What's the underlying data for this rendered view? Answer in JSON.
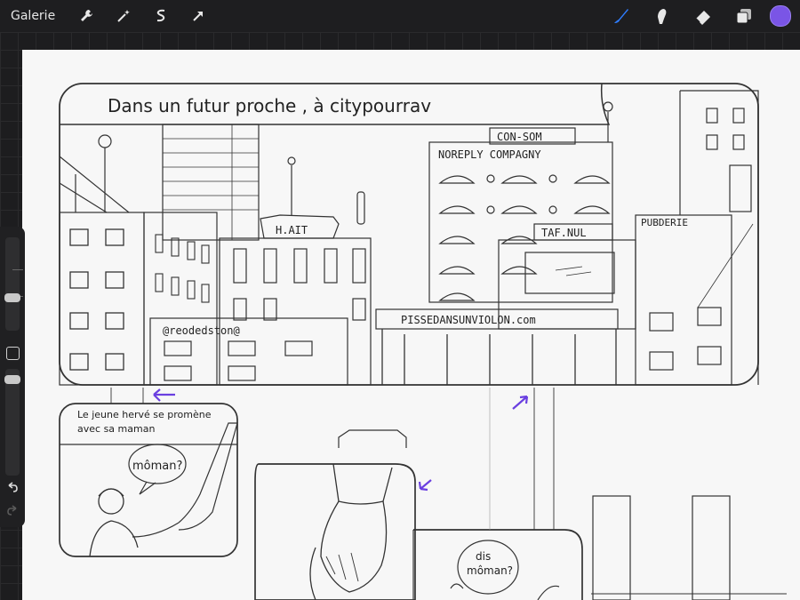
{
  "toolbar": {
    "gallery_label": "Galerie",
    "left_tools": [
      "wrench-icon",
      "magic-wand-icon",
      "selection-icon",
      "transform-arrow-icon"
    ],
    "right_tools": [
      "brush-icon",
      "smudge-icon",
      "eraser-icon",
      "layers-icon"
    ],
    "active_tool": "brush-icon",
    "current_color": "#7a55e6"
  },
  "sidebar": {
    "brush_size_level": 0.35,
    "opacity_level": 0.1
  },
  "comic": {
    "caption_1": "Dans un futur proche , à citypourrav",
    "sign_consom": "CON-SOM",
    "sign_noreply": "NOREPLY COMPAGNY",
    "sign_tafnul": "TAF.NUL",
    "sign_hait": "H.AIT",
    "sign_reodedston": "@reodedston@",
    "sign_pisse": "PISSEDANSUNVIOLON.com",
    "sign_publicite": "PUBDERIE",
    "caption_2_line1": "Le jeune hervé se promène",
    "caption_2_line2": "avec sa maman",
    "bubble_1": "môman?",
    "bubble_2_line1": "dis",
    "bubble_2_line2": "môman?"
  }
}
